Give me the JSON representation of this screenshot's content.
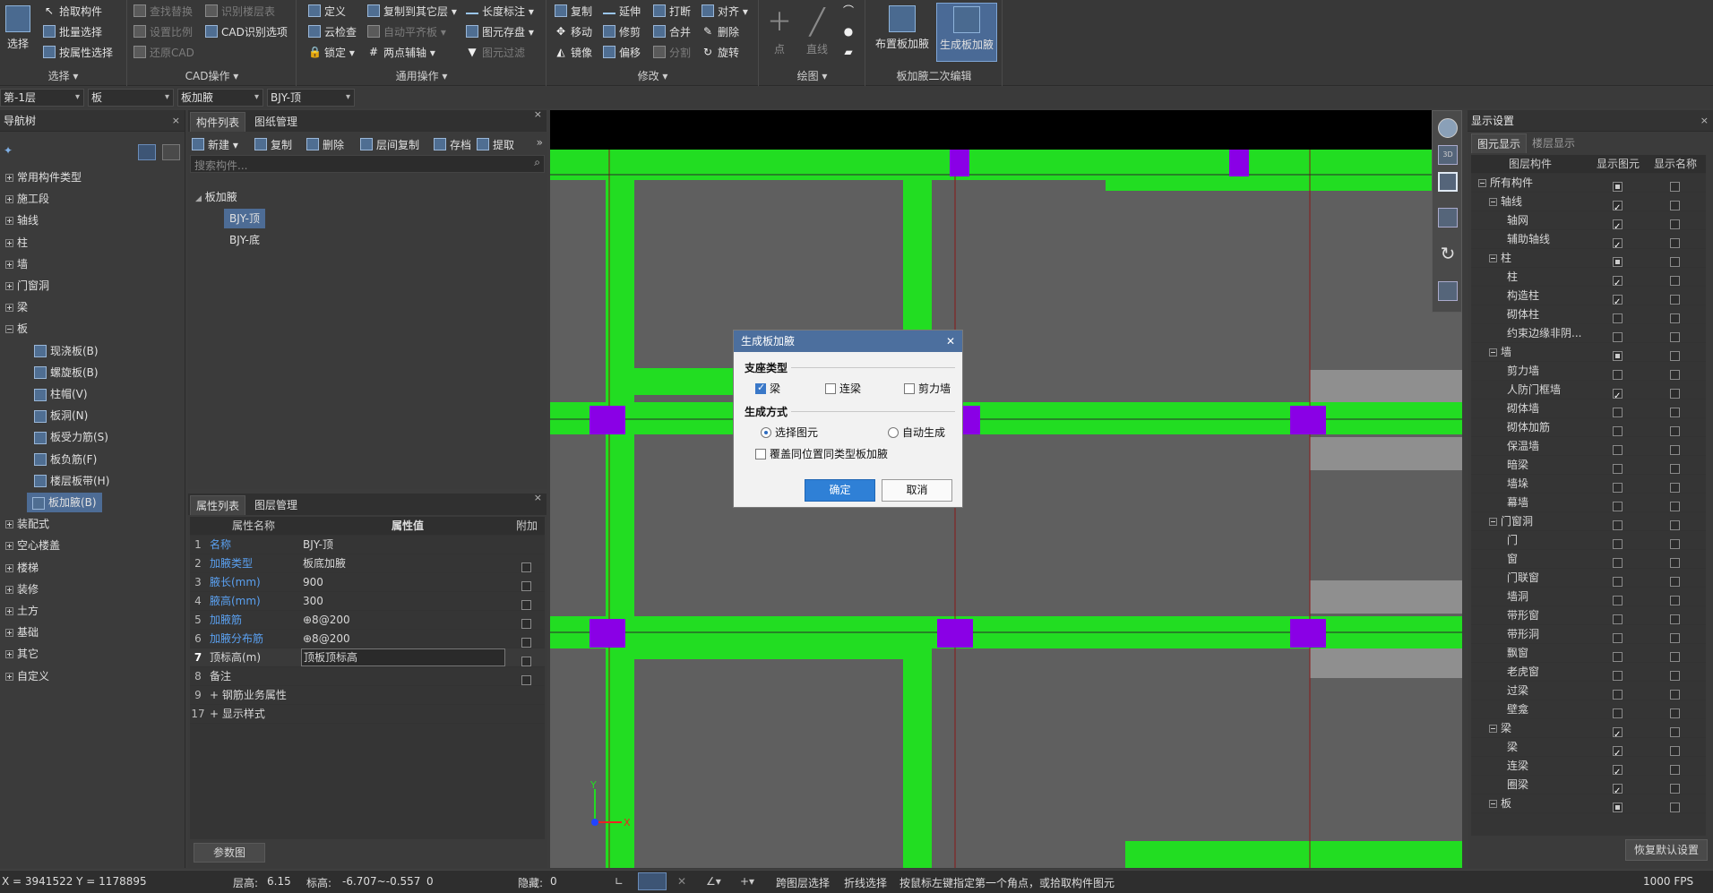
{
  "ribbon": {
    "groups": {
      "select": "选择 ▾",
      "cad": "CAD操作 ▾",
      "general": "通用操作 ▾",
      "modify": "修改 ▾",
      "draw": "绘图 ▾",
      "edit2": "板加腋二次编辑"
    },
    "select_big": "选择",
    "select_items": [
      "拾取构件",
      "批量选择",
      "按属性选择"
    ],
    "cad_items": [
      "查找替换",
      "识别楼层表",
      "设置比例",
      "CAD识别选项",
      "还原CAD"
    ],
    "general_items": [
      "定义",
      "复制到其它层 ▾",
      "长度标注 ▾",
      "云检查",
      "自动平齐板 ▾",
      "图元存盘 ▾",
      "锁定 ▾",
      "两点辅轴 ▾",
      "图元过滤"
    ],
    "modify_items": [
      "复制",
      "延伸",
      "打断",
      "对齐 ▾",
      "移动",
      "修剪",
      "合并",
      "删除",
      "镜像",
      "偏移",
      "分割",
      "旋转"
    ],
    "draw_items": [
      "点",
      "直线"
    ],
    "edit2_items": [
      "布置板加腋",
      "生成板加腋"
    ]
  },
  "toolbar2": {
    "floor": "第-1层",
    "category": "板",
    "type": "板加腋",
    "item": "BJY-顶"
  },
  "nav": {
    "title": "导航树",
    "items": [
      {
        "label": "常用构件类型",
        "level": 0
      },
      {
        "label": "施工段",
        "level": 0
      },
      {
        "label": "轴线",
        "level": 0
      },
      {
        "label": "柱",
        "level": 0
      },
      {
        "label": "墙",
        "level": 0
      },
      {
        "label": "门窗洞",
        "level": 0
      },
      {
        "label": "梁",
        "level": 0
      },
      {
        "label": "板",
        "level": 0
      },
      {
        "label": "现浇板(B)",
        "level": 1
      },
      {
        "label": "螺旋板(B)",
        "level": 1
      },
      {
        "label": "柱帽(V)",
        "level": 1
      },
      {
        "label": "板洞(N)",
        "level": 1
      },
      {
        "label": "板受力筋(S)",
        "level": 1
      },
      {
        "label": "板负筋(F)",
        "level": 1
      },
      {
        "label": "楼层板带(H)",
        "level": 1
      },
      {
        "label": "板加腋(B)",
        "level": 1
      },
      {
        "label": "装配式",
        "level": 0
      },
      {
        "label": "空心楼盖",
        "level": 0
      },
      {
        "label": "楼梯",
        "level": 0
      },
      {
        "label": "装修",
        "level": 0
      },
      {
        "label": "土方",
        "level": 0
      },
      {
        "label": "基础",
        "level": 0
      },
      {
        "label": "其它",
        "level": 0
      },
      {
        "label": "自定义",
        "level": 0
      }
    ]
  },
  "component_list": {
    "tabs": [
      "构件列表",
      "图纸管理"
    ],
    "toolbar": [
      "新建 ▾",
      "复制",
      "删除",
      "层间复制",
      "存档",
      "提取"
    ],
    "search_placeholder": "搜索构件...",
    "root": "板加腋",
    "children": [
      "BJY-顶",
      "BJY-底"
    ]
  },
  "properties": {
    "tabs": [
      "属性列表",
      "图层管理"
    ],
    "headers": [
      "属性名称",
      "属性值",
      "附加"
    ],
    "rows": [
      {
        "num": "1",
        "name": "名称",
        "value": "BJY-顶",
        "blue": true,
        "chk": false
      },
      {
        "num": "2",
        "name": "加腋类型",
        "value": "板底加腋",
        "blue": true,
        "chk": true
      },
      {
        "num": "3",
        "name": "腋长(mm)",
        "value": "900",
        "blue": true,
        "chk": true
      },
      {
        "num": "4",
        "name": "腋高(mm)",
        "value": "300",
        "blue": true,
        "chk": true
      },
      {
        "num": "5",
        "name": "加腋筋",
        "value": "⊕8@200",
        "blue": true,
        "chk": true
      },
      {
        "num": "6",
        "name": "加腋分布筋",
        "value": "⊕8@200",
        "blue": true,
        "chk": true
      },
      {
        "num": "7",
        "name": "顶标高(m)",
        "value": "顶板顶标高",
        "blue": false,
        "chk": true
      },
      {
        "num": "8",
        "name": "备注",
        "value": "",
        "blue": false,
        "chk": true
      },
      {
        "num": "9",
        "name": "+ 钢筋业务属性",
        "value": "",
        "blue": false,
        "chk": false
      },
      {
        "num": "17",
        "name": "+ 显示样式",
        "value": "",
        "blue": false,
        "chk": false
      }
    ],
    "param_button": "参数图"
  },
  "dialog": {
    "title": "生成板加腋",
    "support_label": "支座类型",
    "support_options": [
      {
        "label": "梁",
        "checked": true
      },
      {
        "label": "连梁",
        "checked": false
      },
      {
        "label": "剪力墙",
        "checked": false
      }
    ],
    "mode_label": "生成方式",
    "mode_options": [
      {
        "label": "选择图元",
        "checked": true
      },
      {
        "label": "自动生成",
        "checked": false
      }
    ],
    "overwrite": "覆盖同位置同类型板加腋",
    "ok": "确定",
    "cancel": "取消"
  },
  "display": {
    "title": "显示设置",
    "tabs": [
      "图元显示",
      "楼层显示"
    ],
    "headers": [
      "图层构件",
      "显示图元",
      "显示名称"
    ],
    "rows": [
      {
        "label": "所有构件",
        "level": 0,
        "show": "sq",
        "name": ""
      },
      {
        "label": "轴线",
        "level": 1,
        "show": "on",
        "name": ""
      },
      {
        "label": "轴网",
        "level": 2,
        "show": "on",
        "name": ""
      },
      {
        "label": "辅助轴线",
        "level": 2,
        "show": "on",
        "name": ""
      },
      {
        "label": "柱",
        "level": 1,
        "show": "sq",
        "name": ""
      },
      {
        "label": "柱",
        "level": 2,
        "show": "on",
        "name": ""
      },
      {
        "label": "构造柱",
        "level": 2,
        "show": "on",
        "name": ""
      },
      {
        "label": "砌体柱",
        "level": 2,
        "show": "",
        "name": ""
      },
      {
        "label": "约束边缘非阴...",
        "level": 2,
        "show": "",
        "name": ""
      },
      {
        "label": "墙",
        "level": 1,
        "show": "sq",
        "name": ""
      },
      {
        "label": "剪力墙",
        "level": 2,
        "show": "",
        "name": ""
      },
      {
        "label": "人防门框墙",
        "level": 2,
        "show": "on",
        "name": ""
      },
      {
        "label": "砌体墙",
        "level": 2,
        "show": "",
        "name": ""
      },
      {
        "label": "砌体加筋",
        "level": 2,
        "show": "",
        "name": ""
      },
      {
        "label": "保温墙",
        "level": 2,
        "show": "",
        "name": ""
      },
      {
        "label": "暗梁",
        "level": 2,
        "show": "",
        "name": ""
      },
      {
        "label": "墙垛",
        "level": 2,
        "show": "",
        "name": ""
      },
      {
        "label": "幕墙",
        "level": 2,
        "show": "",
        "name": ""
      },
      {
        "label": "门窗洞",
        "level": 1,
        "show": "",
        "name": ""
      },
      {
        "label": "门",
        "level": 2,
        "show": "",
        "name": ""
      },
      {
        "label": "窗",
        "level": 2,
        "show": "",
        "name": ""
      },
      {
        "label": "门联窗",
        "level": 2,
        "show": "",
        "name": ""
      },
      {
        "label": "墙洞",
        "level": 2,
        "show": "",
        "name": ""
      },
      {
        "label": "带形窗",
        "level": 2,
        "show": "",
        "name": ""
      },
      {
        "label": "带形洞",
        "level": 2,
        "show": "",
        "name": ""
      },
      {
        "label": "飘窗",
        "level": 2,
        "show": "",
        "name": ""
      },
      {
        "label": "老虎窗",
        "level": 2,
        "show": "",
        "name": ""
      },
      {
        "label": "过梁",
        "level": 2,
        "show": "",
        "name": ""
      },
      {
        "label": "壁龛",
        "level": 2,
        "show": "",
        "name": ""
      },
      {
        "label": "梁",
        "level": 1,
        "show": "on",
        "name": ""
      },
      {
        "label": "梁",
        "level": 2,
        "show": "on",
        "name": ""
      },
      {
        "label": "连梁",
        "level": 2,
        "show": "on",
        "name": ""
      },
      {
        "label": "圈梁",
        "level": 2,
        "show": "on",
        "name": ""
      },
      {
        "label": "板",
        "level": 1,
        "show": "sq",
        "name": ""
      }
    ],
    "restore": "恢复默认设置"
  },
  "canvas": {
    "axis_y": "Y",
    "axis_x": "X"
  },
  "status": {
    "coords": "X = 3941522 Y = 1178895",
    "floor_height_label": "层高:",
    "floor_height": "6.15",
    "elev_label": "标高:",
    "elev": "-6.707~-0.557",
    "zero": "0",
    "hidden_label": "隐藏:",
    "hidden": "0",
    "cross_layer": "跨图层选择",
    "polyline": "折线选择",
    "hint": "按鼠标左键指定第一个角点，或拾取构件图元",
    "fps": "1000 FPS"
  },
  "colors": {
    "beam": "#22dd22",
    "column": "#8a00e6",
    "axis": "#8a1818",
    "accent": "#4d6c95"
  }
}
